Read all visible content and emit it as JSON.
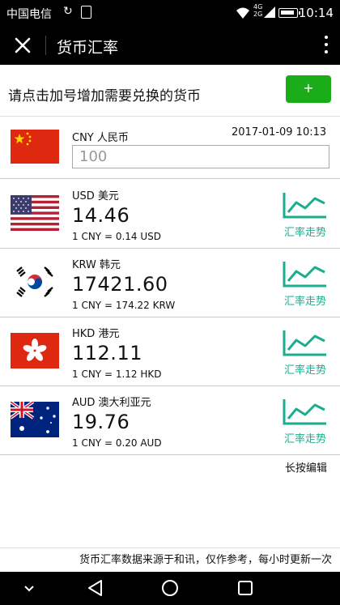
{
  "status_bar": {
    "carrier": "中国电信",
    "network": "4G 2G",
    "time": "10:14"
  },
  "app_bar": {
    "title": "货币汇率"
  },
  "prompt": {
    "text": "请点击加号增加需要兑换的货币",
    "add_label": "+"
  },
  "base": {
    "code_name": "CNY 人民币",
    "timestamp": "2017-01-09 10:13",
    "amount": "100"
  },
  "currencies": [
    {
      "code_name": "USD 美元",
      "value": "14.46",
      "rate": "1 CNY = 0.14 USD",
      "trend_label": "汇率走势"
    },
    {
      "code_name": "KRW 韩元",
      "value": "17421.60",
      "rate": "1 CNY = 174.22 KRW",
      "trend_label": "汇率走势"
    },
    {
      "code_name": "HKD 港元",
      "value": "112.11",
      "rate": "1 CNY = 1.12 HKD",
      "trend_label": "汇率走势"
    },
    {
      "code_name": "AUD 澳大利亚元",
      "value": "19.76",
      "rate": "1 CNY = 0.20 AUD",
      "trend_label": "汇率走势"
    }
  ],
  "edit_hint": "长按编辑",
  "footer": "货币汇率数据来源于和讯，仅作参考，每小时更新一次",
  "colors": {
    "accent_green": "#1aad19",
    "trend_teal": "#1aad8f"
  },
  "icons": [
    "close-icon",
    "more-icon",
    "trend-chart-icon",
    "back-icon",
    "home-icon",
    "recents-icon"
  ]
}
